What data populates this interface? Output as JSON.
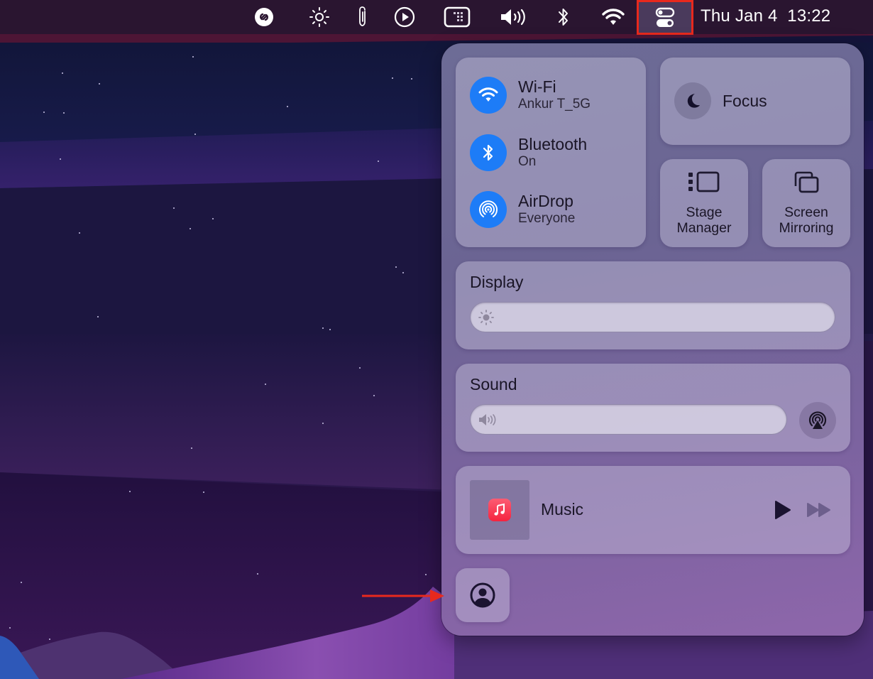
{
  "menubar": {
    "icons": [
      {
        "name": "shazam-icon"
      },
      {
        "name": "brightness-icon"
      },
      {
        "name": "paperclip-icon"
      },
      {
        "name": "play-circle-icon"
      },
      {
        "name": "keyboard-brightness-icon"
      },
      {
        "name": "volume-icon"
      },
      {
        "name": "bluetooth-icon"
      },
      {
        "name": "wifi-icon"
      },
      {
        "name": "control-center-icon",
        "highlighted": true
      }
    ],
    "date": "Thu Jan 4",
    "time": "13:22",
    "highlight_color": "#e8291d"
  },
  "control_center": {
    "connectivity": {
      "wifi": {
        "title": "Wi-Fi",
        "subtitle": "Ankur T_5G",
        "active": true
      },
      "bluetooth": {
        "title": "Bluetooth",
        "subtitle": "On",
        "active": true
      },
      "airdrop": {
        "title": "AirDrop",
        "subtitle": "Everyone",
        "active": true
      },
      "accent_color": "#1d7cf7"
    },
    "focus": {
      "label": "Focus"
    },
    "stage_manager": {
      "label_line1": "Stage",
      "label_line2": "Manager"
    },
    "screen_mirroring": {
      "label_line1": "Screen",
      "label_line2": "Mirroring"
    },
    "display": {
      "label": "Display",
      "brightness": 0
    },
    "sound": {
      "label": "Sound",
      "volume": 0
    },
    "now_playing": {
      "app": "Music"
    },
    "user": {
      "icon": "user-circle-icon"
    }
  },
  "annotation": {
    "type": "arrow",
    "color": "#e8291d",
    "points_to": "user-switch-button"
  }
}
